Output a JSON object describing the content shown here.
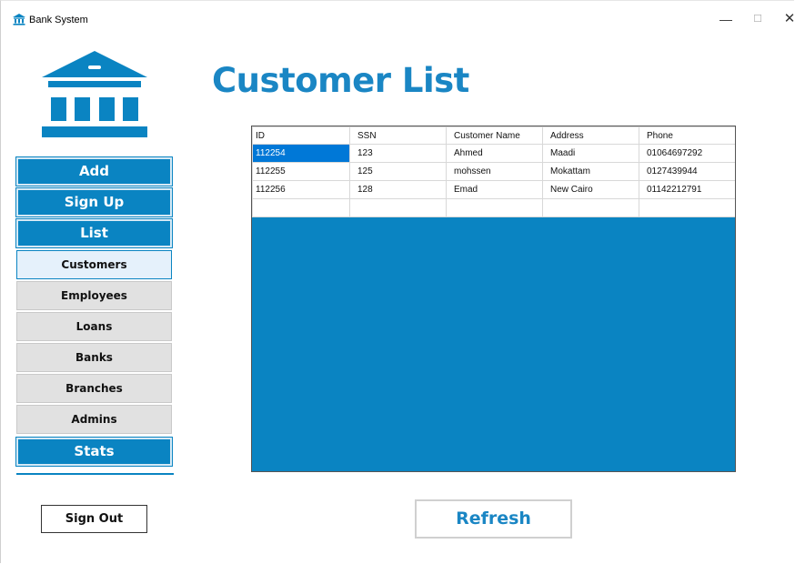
{
  "window": {
    "title": "Bank System",
    "min_icon": "—",
    "max_icon": "☐",
    "close_icon": "✕"
  },
  "page": {
    "title": "Customer List"
  },
  "colors": {
    "accent": "#0a84c2",
    "title": "#1a86c4",
    "selection": "#0078d7"
  },
  "sidebar": {
    "main": [
      {
        "label": "Add"
      },
      {
        "label": "Sign Up"
      },
      {
        "label": "List"
      }
    ],
    "sub": [
      {
        "label": "Customers",
        "active": true
      },
      {
        "label": "Employees"
      },
      {
        "label": "Loans"
      },
      {
        "label": "Banks"
      },
      {
        "label": "Branches"
      },
      {
        "label": "Admins"
      }
    ],
    "stats_label": "Stats",
    "signout_label": "Sign Out"
  },
  "table": {
    "columns": [
      "ID",
      "SSN",
      "Customer Name",
      "Address",
      "Phone"
    ],
    "rows": [
      [
        "112254",
        "123",
        "Ahmed",
        "Maadi",
        "01064697292"
      ],
      [
        "112255",
        "125",
        "mohssen",
        "Mokattam",
        "0127439944"
      ],
      [
        "112256",
        "128",
        "Emad",
        "New Cairo",
        "01142212791"
      ]
    ]
  },
  "refresh_label": "Refresh"
}
